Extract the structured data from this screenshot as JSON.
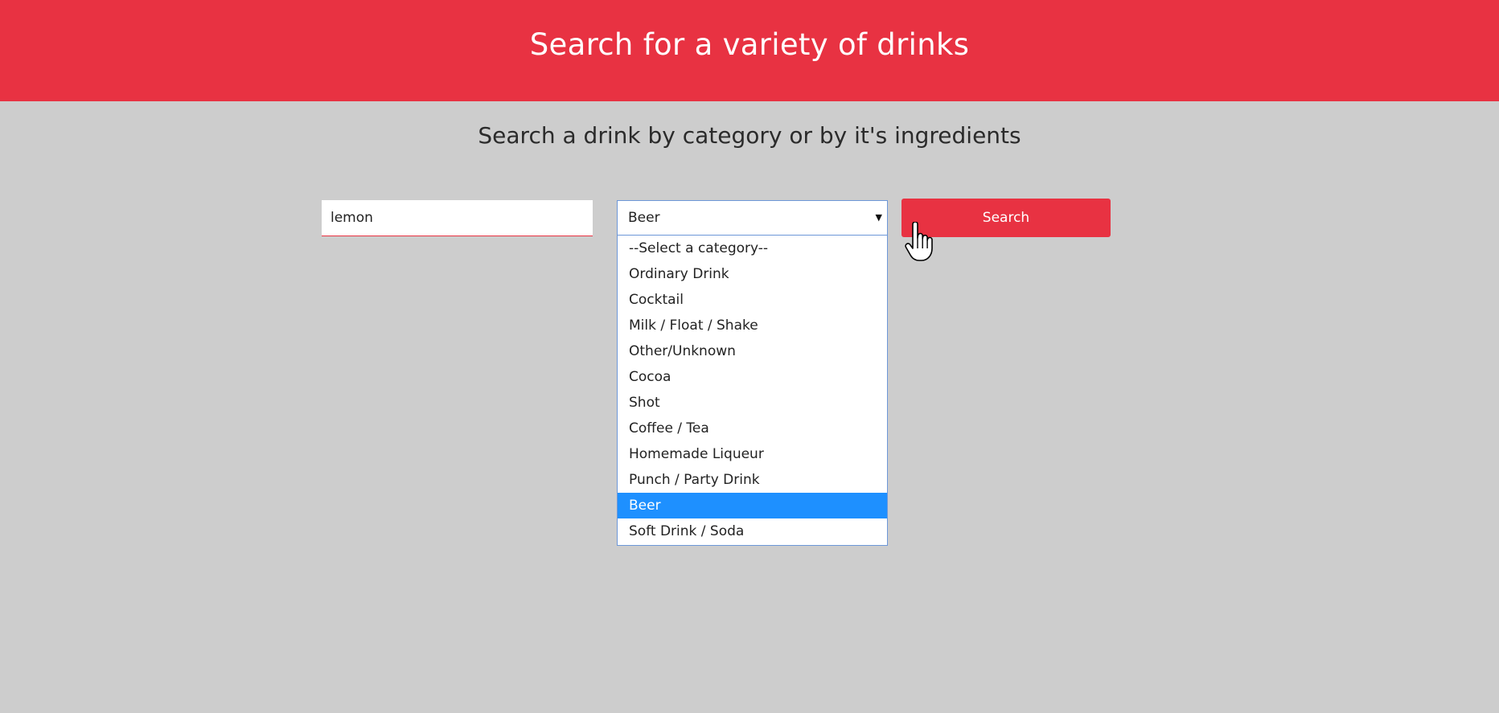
{
  "header": {
    "title": "Search for a variety of drinks"
  },
  "subtitle": "Search a drink by category or by it's ingredients",
  "ingredient_input": {
    "value": "lemon"
  },
  "category_select": {
    "selected": "Beer",
    "options": [
      "--Select a category--",
      "Ordinary Drink",
      "Cocktail",
      "Milk / Float / Shake",
      "Other/Unknown",
      "Cocoa",
      "Shot",
      "Coffee / Tea",
      "Homemade Liqueur",
      "Punch / Party Drink",
      "Beer",
      "Soft Drink / Soda"
    ]
  },
  "search_button": {
    "label": "Search"
  },
  "icons": {
    "dropdown_arrow": "caret-down-icon",
    "cursor": "hand-pointer-icon"
  },
  "colors": {
    "brand_red": "#e83242",
    "page_background": "#cdcdcd",
    "highlight_blue": "#1e90ff",
    "focus_border": "#6d97d8"
  }
}
